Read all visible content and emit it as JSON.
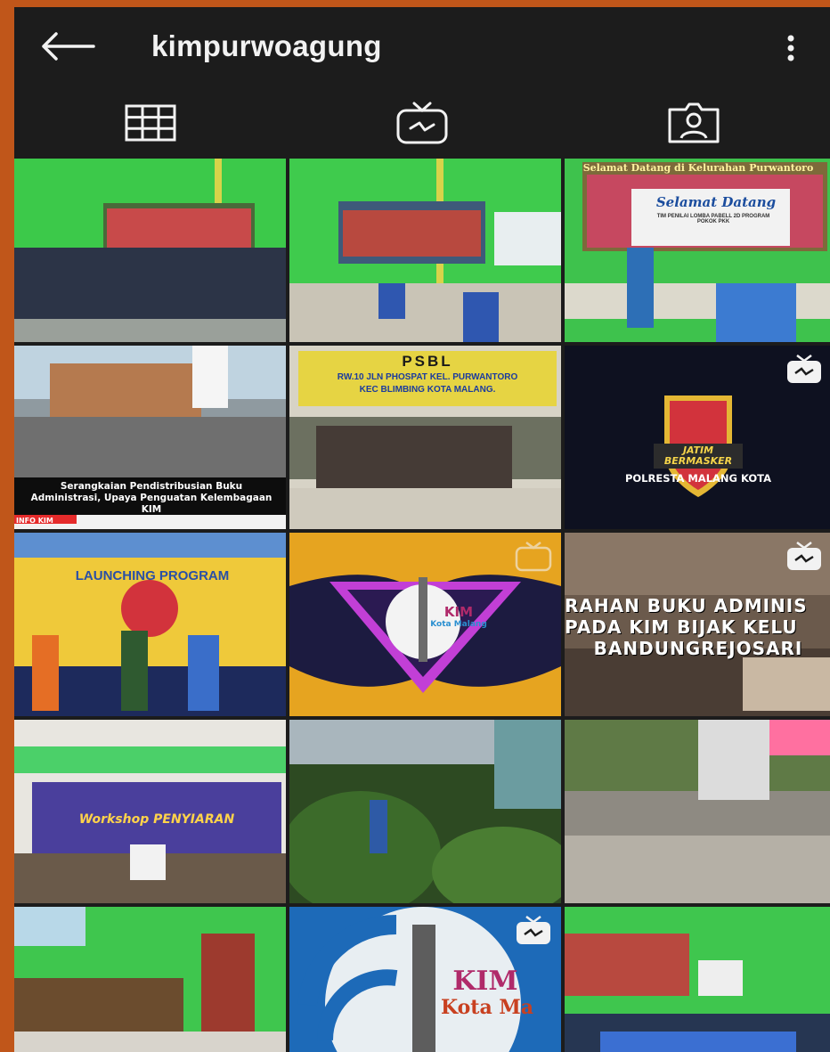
{
  "header": {
    "username": "kimpurwoagung",
    "back_icon": "arrow-left-icon",
    "menu_icon": "more-vertical-icon"
  },
  "tabs": [
    {
      "icon": "grid-icon",
      "name": "posts"
    },
    {
      "icon": "igtv-icon",
      "name": "igtv"
    },
    {
      "icon": "tagged-icon",
      "name": "tagged"
    }
  ],
  "posts": {
    "p3_banner": "Selamat Datang di Kelurahan Purwantoro",
    "p3_sign_title": "Selamat Datang",
    "p3_sign_sub": "TIM PENILAI LOMBA PABELL 2D PROGRAM POKOK PKK",
    "p4_caption": "Serangkaian Pendistribusian Buku Administrasi, Upaya Penguatan Kelembagaan KIM",
    "p4_footer": "INFO KIM",
    "p5_banner_title": "PSBL",
    "p5_banner_line1": "RW.10 JLN PHOSPAT KEL. PURWANTORO",
    "p5_banner_line2": "KEC BLIMBING KOTA MALANG.",
    "p6_caption": "POLRESTA MALANG KOTA",
    "p6_logo": "JATIM BERMASKER",
    "p7_banner": "LAUNCHING PROGRAM",
    "p8_logo": "KIM",
    "p8_logo_sub": "Kota Malang",
    "p9_line1": "RAHAN BUKU ADMINIS",
    "p9_line2": "PADA KIM BIJAK KELU",
    "p9_line3": "BANDUNGREJOSARI",
    "p10_title": "Workshop PENYIARAN",
    "p14_logo": "KIM",
    "p14_logo_sub": "Kota Ma"
  },
  "colors": {
    "background": "#1c1c1c",
    "outer": "#c0561a",
    "icon": "#f2f2f2"
  }
}
